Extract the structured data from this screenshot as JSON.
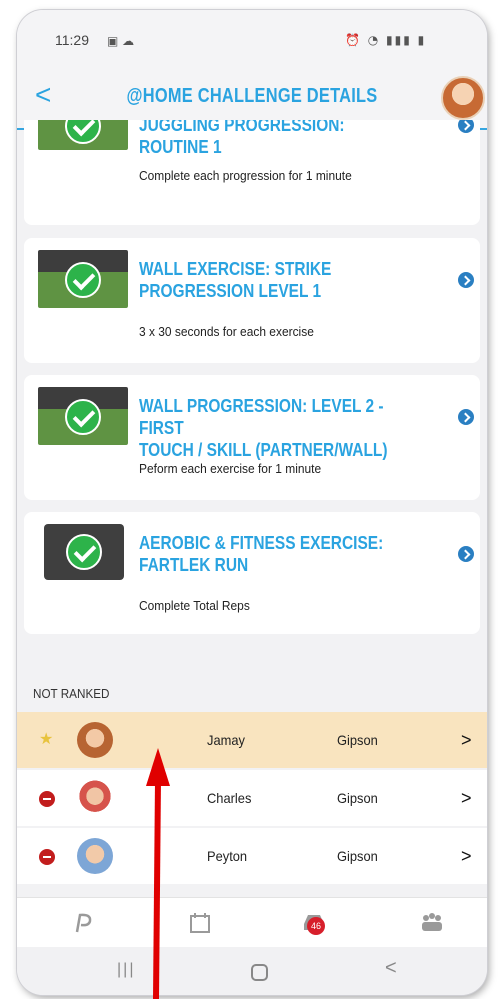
{
  "status_bar": {
    "time": "11:29"
  },
  "header": {
    "title": "@HOME CHALLENGE DETAILS"
  },
  "exercises": [
    {
      "title": "JUGGLING PROGRESSION: ROUTINE 1",
      "description": "Complete each progression for 1 minute"
    },
    {
      "title": "WALL EXERCISE: STRIKE\nPROGRESSION LEVEL 1",
      "description": "3 x 30 seconds for each exercise"
    },
    {
      "title": "WALL PROGRESSION: LEVEL 2 - FIRST\nTOUCH / SKILL (PARTNER/WALL)",
      "description": "Peform each exercise for 1 minute"
    },
    {
      "title": "AEROBIC & FITNESS EXERCISE:\nFARTLEK RUN",
      "description": "Complete Total Reps"
    }
  ],
  "ranking": {
    "section_label": "NOT RANKED",
    "rows": [
      {
        "first": "Jamay",
        "last": "Gipson",
        "status": "star",
        "highlighted": true
      },
      {
        "first": "Charles",
        "last": "Gipson",
        "status": "not-ranked",
        "highlighted": false
      },
      {
        "first": "Peyton",
        "last": "Gipson",
        "status": "not-ranked",
        "highlighted": false
      }
    ]
  },
  "tabbar": {
    "inbox_badge": "46"
  },
  "colors": {
    "accent": "#2aa3e0",
    "check_green": "#2db34a",
    "highlight_row": "#f9e4bf",
    "annotation_arrow": "#e00000"
  }
}
